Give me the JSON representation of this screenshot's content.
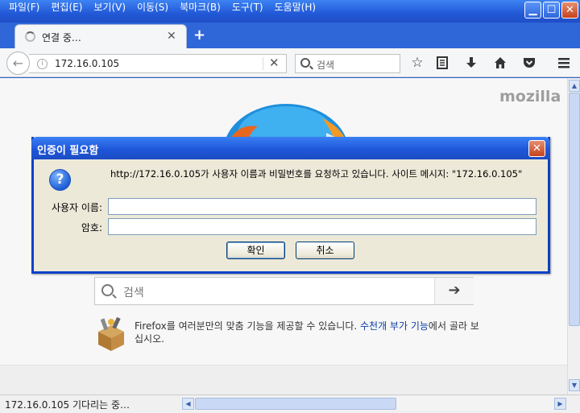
{
  "window": {
    "menu": [
      "파일(F)",
      "편집(E)",
      "보기(V)",
      "이동(S)",
      "북마크(B)",
      "도구(T)",
      "도움말(H)"
    ],
    "controls": {
      "minimize": "▁",
      "maximize": "☐",
      "close": "✕"
    }
  },
  "tab": {
    "title": "연결 중…",
    "close": "✕",
    "new_tab": "+"
  },
  "toolbar": {
    "back": "←",
    "info": "i",
    "url": "172.16.0.105",
    "clear": "✕",
    "search_placeholder": "검색",
    "icons": [
      "bookmark-star-icon",
      "reading-list-icon",
      "download-icon",
      "home-icon",
      "pocket-icon",
      "hamburger-menu-icon"
    ]
  },
  "page": {
    "brand": "mozilla",
    "search_placeholder": "검색",
    "search_go": "➔",
    "snippet_text": "Firefox를 여러분만의 맞춤 기능을 제공할 수 있습니다. ",
    "snippet_link": "수천개 부가 기능",
    "snippet_tail": "에서 골라 보십시오."
  },
  "dialog": {
    "title": "인증이 필요함",
    "close": "✕",
    "icon": "?",
    "message": "http://172.16.0.105가 사용자 이름과 비밀번호를 요청하고 있습니다. 사이트 메시지: \"172.16.0.105\"",
    "username_label": "사용자 이름:",
    "username_value": "",
    "password_label": "암호:",
    "password_value": "",
    "ok": "확인",
    "cancel": "취소"
  },
  "status": {
    "text": "172.16.0.105 기다리는 중…"
  },
  "scroll": {
    "up": "▲",
    "down": "▼",
    "left": "◀",
    "right": "▶"
  }
}
